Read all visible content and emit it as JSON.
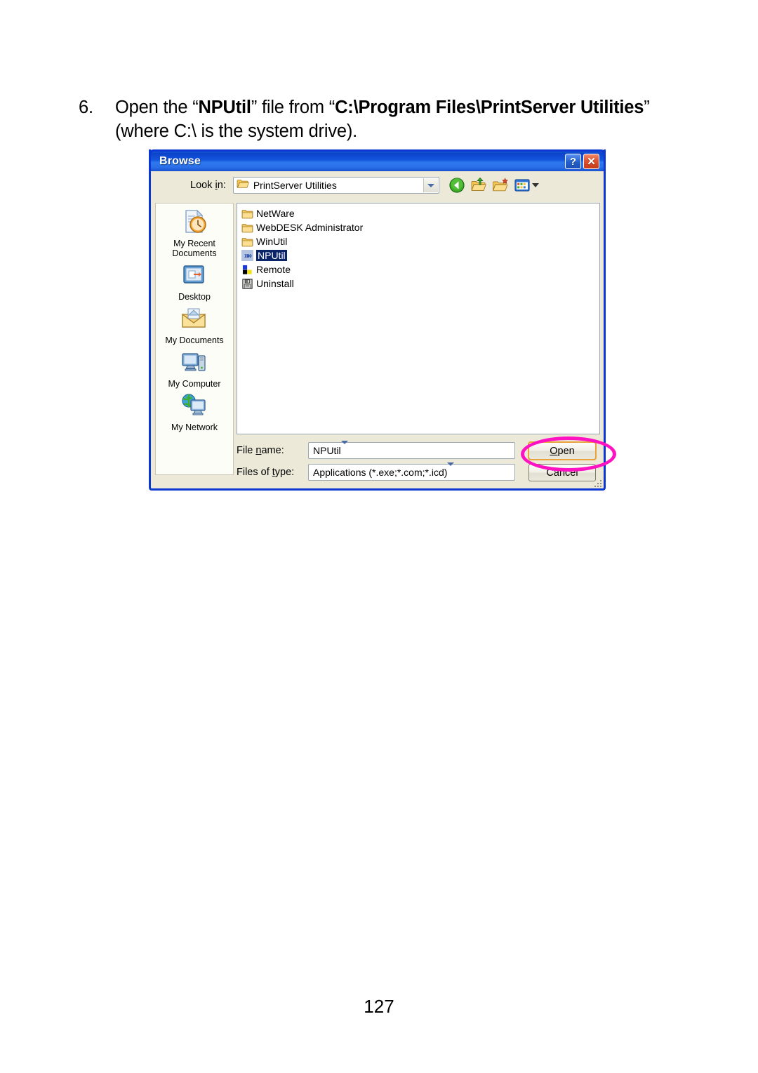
{
  "document": {
    "step_number": "6.",
    "instruction_part1": "Open the “",
    "instruction_bold1": "NPUtil",
    "instruction_part2": "” file from “",
    "instruction_bold2": "C:\\Program Files\\PrintServer Utilities",
    "instruction_part3": "” (where C:\\ is the system drive).",
    "page_number": "127"
  },
  "dialog": {
    "title": "Browse",
    "help_button": "?",
    "close_button": "✕",
    "lookin": {
      "label_pre": "Look ",
      "label_accel": "i",
      "label_post": "n:",
      "value": "PrintServer Utilities",
      "icon": "open-folder-icon"
    },
    "toolbar": [
      {
        "name": "back-button",
        "icon": "back-arrow-icon"
      },
      {
        "name": "up-one-level-button",
        "icon": "up-folder-icon"
      },
      {
        "name": "create-new-folder-button",
        "icon": "new-folder-icon"
      },
      {
        "name": "views-button",
        "icon": "views-icon"
      }
    ],
    "places": [
      {
        "label": "My Recent Documents",
        "icon": "recent-documents-icon"
      },
      {
        "label": "Desktop",
        "icon": "desktop-icon"
      },
      {
        "label": "My Documents",
        "icon": "my-documents-icon"
      },
      {
        "label": "My Computer",
        "icon": "my-computer-icon"
      },
      {
        "label": "My Network",
        "icon": "my-network-icon"
      }
    ],
    "files": [
      {
        "name": "NetWare",
        "icon": "folder-icon",
        "selected": false
      },
      {
        "name": "WebDESK Administrator",
        "icon": "folder-icon",
        "selected": false
      },
      {
        "name": "WinUtil",
        "icon": "folder-icon",
        "selected": false
      },
      {
        "name": "NPUtil",
        "icon": "chevron-app-icon",
        "selected": true
      },
      {
        "name": "Remote",
        "icon": "squares-app-icon",
        "selected": false
      },
      {
        "name": "Uninstall",
        "icon": "floppy-app-icon",
        "selected": false
      }
    ],
    "filename_field": {
      "label_pre": "File ",
      "label_accel": "n",
      "label_post": "ame:",
      "value": "NPUtil"
    },
    "filetype_field": {
      "label_pre": "Files of ",
      "label_accel": "t",
      "label_post": "ype:",
      "value": "Applications (*.exe;*.com;*.icd)"
    },
    "open_button": {
      "pre": "",
      "accel": "O",
      "post": "pen"
    },
    "cancel_button": "Cancel"
  },
  "annotation": {
    "target": "open-button",
    "color": "#ff12c1",
    "shape": "ellipse"
  }
}
